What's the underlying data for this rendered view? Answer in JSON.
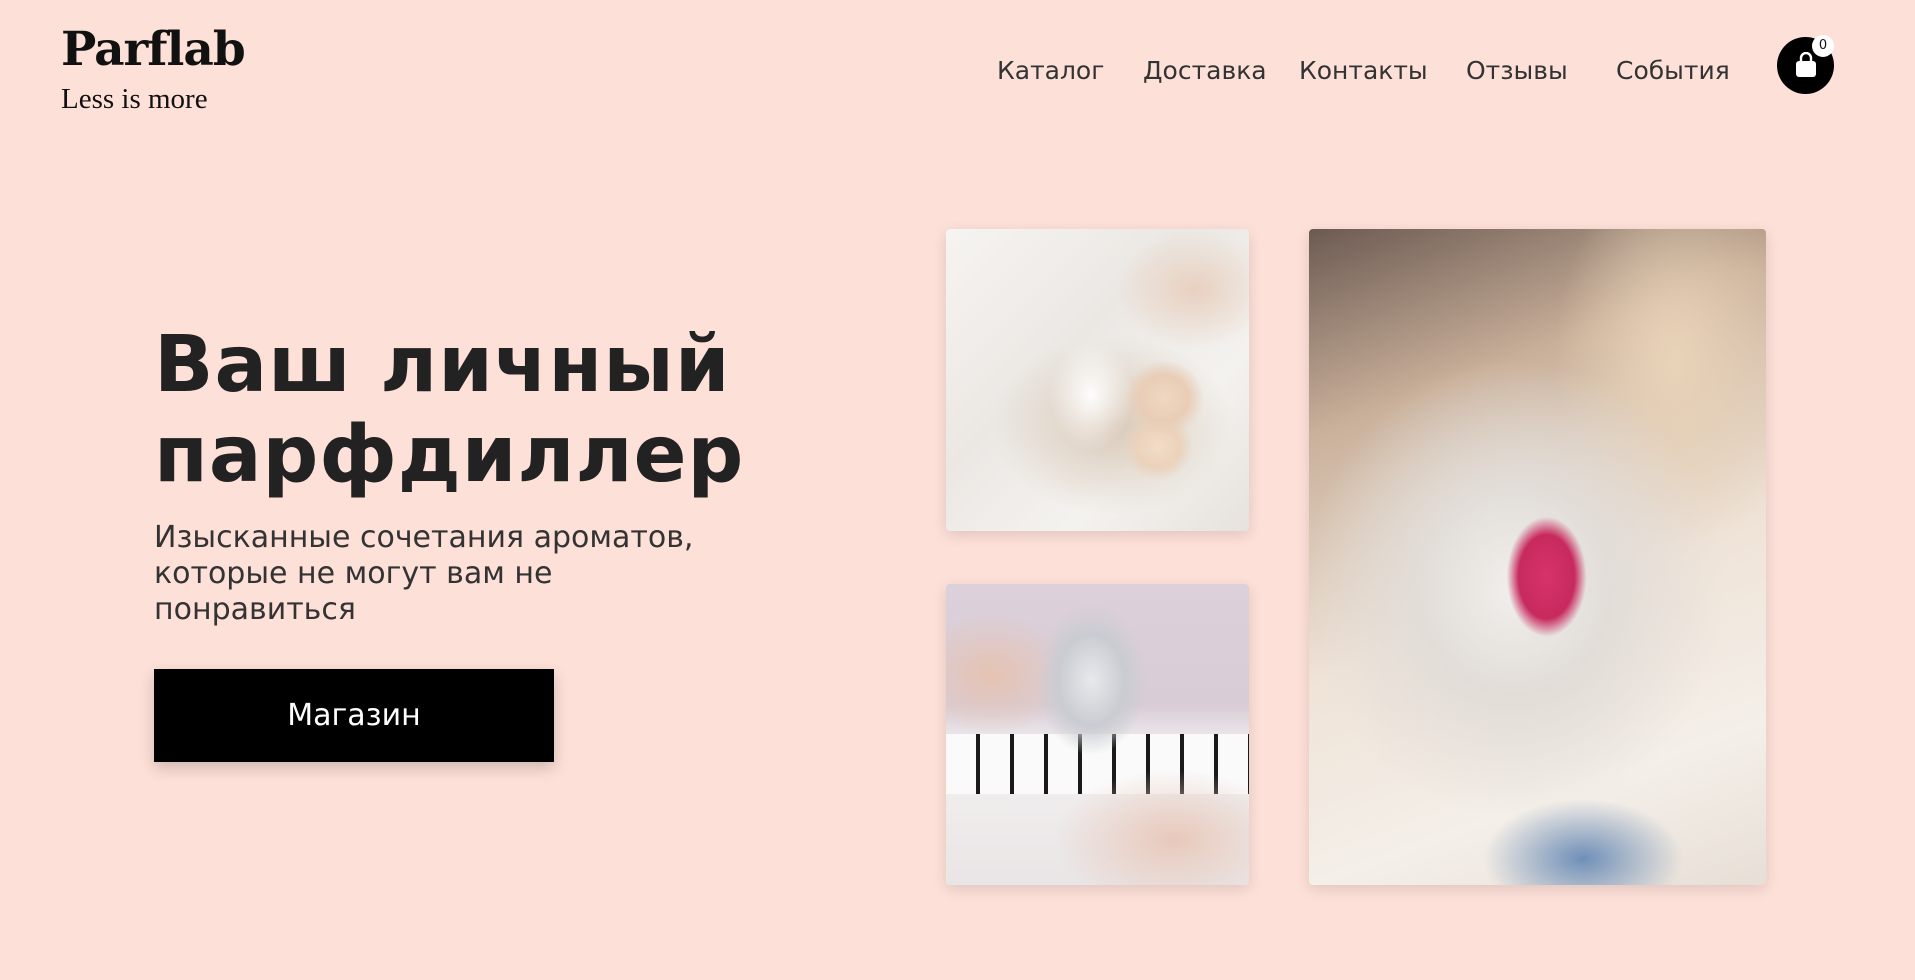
{
  "brand": {
    "name": "Parflab",
    "tagline": "Less is more"
  },
  "nav": {
    "items": [
      {
        "label": "Каталог"
      },
      {
        "label": "Доставка"
      },
      {
        "label": "Контакты"
      },
      {
        "label": "Отзывы"
      },
      {
        "label": "События"
      }
    ]
  },
  "cart": {
    "count": "0",
    "icon": "shopping-bag-icon"
  },
  "hero": {
    "title_line1": "Ваш личный",
    "title_line2": "парфдиллер",
    "subtitle_line1": "Изысканные сочетания ароматов,",
    "subtitle_line2": "которые не могут вам не",
    "subtitle_line3": "понравиться",
    "button_label": "Магазин"
  },
  "colors": {
    "background": "#fde0d8",
    "button": "#000000",
    "text": "#222222"
  }
}
